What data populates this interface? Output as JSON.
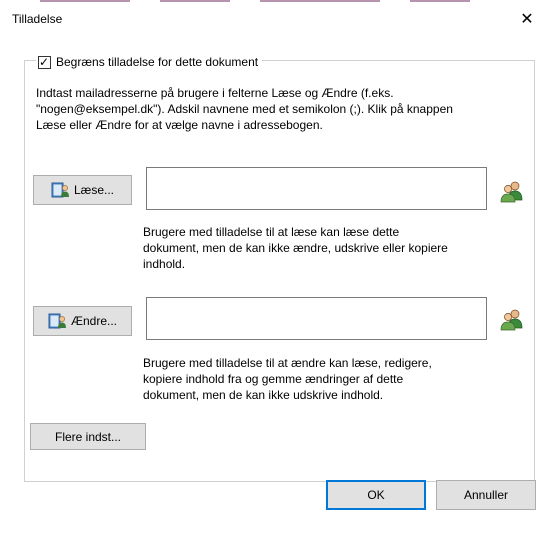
{
  "window": {
    "title": "Tilladelse",
    "close_glyph": "✕"
  },
  "restrict": {
    "checked": true,
    "check_glyph": "✓",
    "label": "Begræns tilladelse for dette dokument"
  },
  "intro_lines": [
    "Indtast mailadresserne på brugere i felterne Læse og Ændre (f.eks.",
    "\"nogen@eksempel.dk\"). Adskil navnene med et semikolon (;). Klik på knappen",
    "Læse eller Ændre for at vælge navne i adressebogen."
  ],
  "read": {
    "button_label": "Læse...",
    "button_icon": "address-book-icon",
    "value": "",
    "lookup_icon": "people-icon",
    "desc_lines": [
      "Brugere med tilladelse til at læse kan læse dette",
      "dokument, men de kan ikke ændre, udskrive eller kopiere",
      "indhold."
    ]
  },
  "change": {
    "button_label": "Ændre...",
    "button_icon": "address-book-icon",
    "value": "",
    "lookup_icon": "people-icon",
    "desc_lines": [
      "Brugere med tilladelse til at ændre kan læse, redigere,",
      "kopiere indhold fra og gemme ændringer af dette",
      "dokument, men de kan ikke udskrive indhold."
    ]
  },
  "more_button": "Flere indst...",
  "footer": {
    "ok": "OK",
    "cancel": "Annuller"
  },
  "colors": {
    "accent": "#0078d7",
    "button_face": "#e1e1e1",
    "button_border": "#adadad"
  }
}
